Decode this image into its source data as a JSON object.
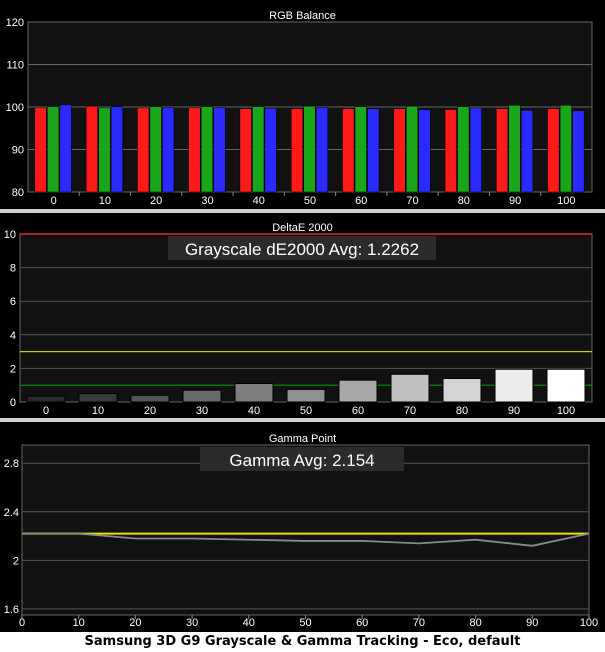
{
  "caption": "Samsung 3D G9 Grayscale & Gamma Tracking - Eco, default",
  "colors": {
    "panel_bg": "#000000",
    "plot_bg": "#111111",
    "text": "#ffffff",
    "red": "#ff1a1a",
    "green": "#1aa61a",
    "blue": "#2a2aff",
    "threshold_red": "#ff3333",
    "threshold_yellow": "#cccc00",
    "threshold_green": "#0f8f0f",
    "gamma_target": "#e6e600",
    "gamma_measured": "#888888"
  },
  "chart_data": [
    {
      "type": "bar",
      "title": "RGB Balance",
      "categories": [
        "0",
        "10",
        "20",
        "30",
        "40",
        "50",
        "60",
        "70",
        "80",
        "90",
        "100"
      ],
      "series": [
        {
          "name": "Red",
          "values": [
            99.8,
            100.2,
            99.8,
            99.8,
            99.6,
            99.6,
            99.6,
            99.6,
            99.4,
            99.6,
            99.6
          ]
        },
        {
          "name": "Green",
          "values": [
            100.1,
            99.8,
            100.1,
            100.1,
            100.1,
            100.2,
            100.1,
            100.2,
            100.1,
            100.4,
            100.4
          ]
        },
        {
          "name": "Blue",
          "values": [
            100.5,
            100.1,
            99.9,
            99.9,
            99.7,
            99.9,
            99.6,
            99.4,
            99.8,
            99.2,
            99.1
          ]
        }
      ],
      "ylim": [
        80,
        120
      ],
      "yticks": [
        "80",
        "90",
        "100",
        "110",
        "120"
      ],
      "grid": true
    },
    {
      "type": "bar",
      "title": "DeltaE 2000",
      "annotation": "Grayscale dE2000 Avg: 1.2262",
      "categories": [
        "0",
        "10",
        "20",
        "30",
        "40",
        "50",
        "60",
        "70",
        "80",
        "90",
        "100"
      ],
      "values": [
        0.35,
        0.5,
        0.4,
        0.7,
        1.1,
        0.75,
        1.3,
        1.65,
        1.4,
        1.95,
        1.95
      ],
      "bar_colors": [
        "#2a2a2a",
        "#3a3a3a",
        "#555555",
        "#6a6a6a",
        "#7d7d7d",
        "#909090",
        "#a8a8a8",
        "#c0c0c0",
        "#d4d4d4",
        "#ececec",
        "#ffffff"
      ],
      "thresholds": [
        10,
        3,
        1
      ],
      "ylim": [
        0,
        10
      ],
      "yticks": [
        "0",
        "2",
        "4",
        "6",
        "8",
        "10"
      ],
      "grid": true
    },
    {
      "type": "line",
      "title": "Gamma Point",
      "annotation": "Gamma Avg: 2.154",
      "x": [
        0,
        10,
        20,
        30,
        40,
        50,
        60,
        70,
        80,
        90,
        100
      ],
      "series": [
        {
          "name": "Target",
          "values": [
            2.22,
            2.22,
            2.22,
            2.22,
            2.22,
            2.22,
            2.22,
            2.22,
            2.22,
            2.22,
            2.22
          ]
        },
        {
          "name": "Measured",
          "values": [
            2.22,
            2.22,
            2.18,
            2.18,
            2.17,
            2.16,
            2.16,
            2.14,
            2.17,
            2.12,
            2.22
          ]
        }
      ],
      "xlim": [
        0,
        100
      ],
      "xticks": [
        "0",
        "10",
        "20",
        "30",
        "40",
        "50",
        "60",
        "70",
        "80",
        "90",
        "100"
      ],
      "ylim": [
        1.55,
        2.95
      ],
      "yticks": [
        "1.6",
        "2",
        "2.4",
        "2.8"
      ],
      "grid": true
    }
  ]
}
